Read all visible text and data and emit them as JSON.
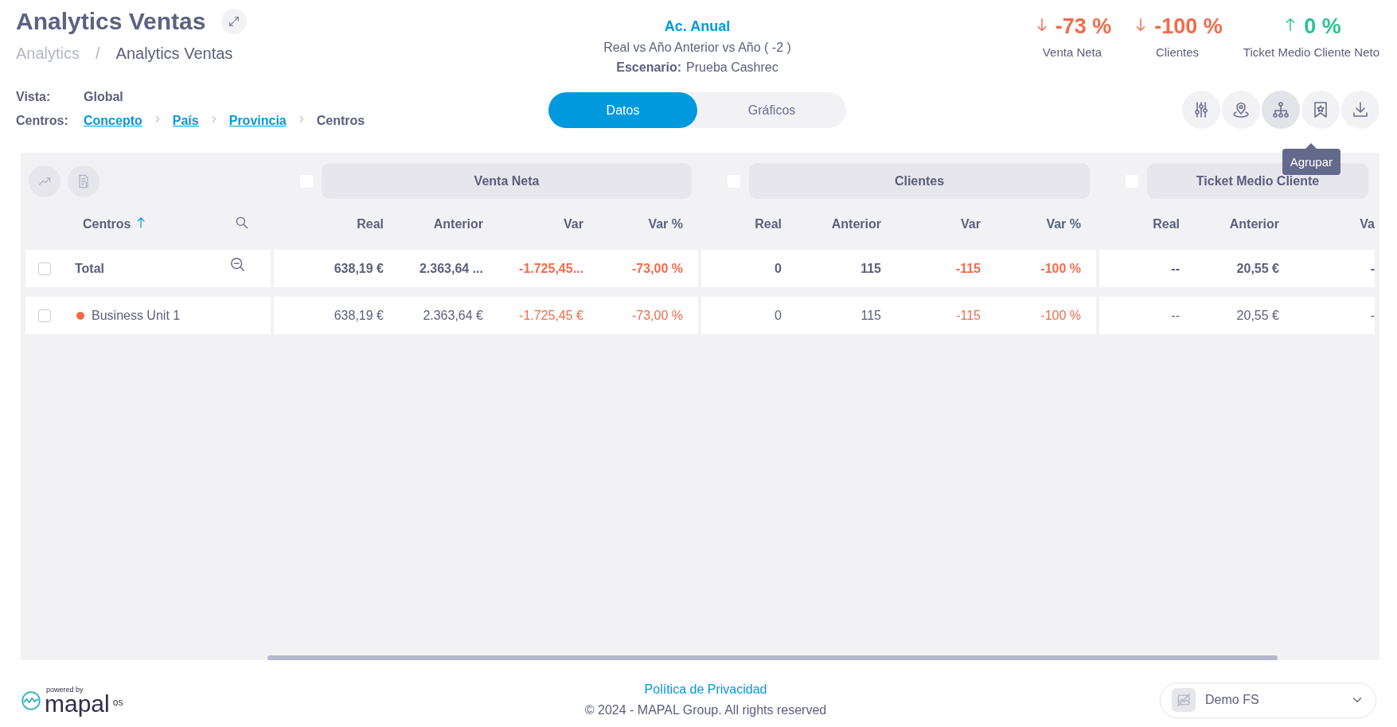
{
  "header": {
    "title": "Analytics Ventas",
    "breadcrumb_separator": "/",
    "breadcrumb": [
      {
        "label": "Analytics",
        "current": false
      },
      {
        "label": "Analytics Ventas",
        "current": true
      }
    ]
  },
  "filters": {
    "vista_label": "Vista:",
    "vista": "Global",
    "centros_label": "Centros:",
    "path": [
      {
        "label": "Concepto",
        "link": true
      },
      {
        "label": "País",
        "link": true
      },
      {
        "label": "Provincia",
        "link": true
      },
      {
        "label": "Centros",
        "link": false
      }
    ]
  },
  "period": {
    "title": "Ac. Anual",
    "comparison": "Real vs Año Anterior vs Año ( -2 )",
    "scenario_label": "Escenario:",
    "scenario": "Prueba Cashrec"
  },
  "view_tabs": [
    {
      "label": "Datos",
      "selected": true
    },
    {
      "label": "Gráficos",
      "selected": false
    }
  ],
  "kpis": [
    {
      "value": "-73 %",
      "label": "Venta Neta",
      "kind": "down"
    },
    {
      "value": "-100 %",
      "label": "Clientes",
      "kind": "down"
    },
    {
      "value": "0 %",
      "label": "Ticket Medio Cliente Neto",
      "kind": "up"
    }
  ],
  "toolbar": {
    "buttons": [
      {
        "kind": "settings",
        "hovered": false
      },
      {
        "kind": "location",
        "hovered": false
      },
      {
        "kind": "group",
        "hovered": true
      },
      {
        "kind": "bookmark",
        "hovered": false
      },
      {
        "kind": "download",
        "hovered": false
      }
    ],
    "tooltip": "Agrupar"
  },
  "table": {
    "tools": [
      {
        "kind": "chart",
        "disabled": true
      },
      {
        "kind": "report",
        "disabled": true
      }
    ],
    "name_column": "Centros",
    "groups": [
      {
        "title": "Venta Neta",
        "checked": false,
        "columns": [
          {
            "label": "Real",
            "kind": "amount"
          },
          {
            "label": "Anterior",
            "kind": "amount"
          },
          {
            "label": "Var",
            "kind": "variance"
          },
          {
            "label": "Var %",
            "kind": "variance"
          }
        ]
      },
      {
        "title": "Clientes",
        "checked": false,
        "columns": [
          {
            "label": "Real",
            "kind": "amount"
          },
          {
            "label": "Anterior",
            "kind": "amount"
          },
          {
            "label": "Var",
            "kind": "variance"
          },
          {
            "label": "Var %",
            "kind": "variance"
          }
        ]
      },
      {
        "title": "Ticket Medio Cliente",
        "checked": false,
        "columns": [
          {
            "label": "Real",
            "kind": "amount"
          },
          {
            "label": "Anterior",
            "kind": "amount"
          },
          {
            "label": "Va",
            "kind": "amount"
          }
        ]
      }
    ],
    "rows": [
      {
        "kind": "total",
        "name": "Total",
        "checked": false,
        "cells": [
          [
            "638,19 €",
            "2.363,64 ...",
            "-1.725,45...",
            "-73,00 %"
          ],
          [
            "0",
            "115",
            "-115",
            "-100 %"
          ],
          [
            "--",
            "20,55 €",
            "-"
          ]
        ]
      },
      {
        "kind": "item",
        "name": "Business Unit 1",
        "checked": false,
        "color": "#f26b4a",
        "cells": [
          [
            "638,19 €",
            "2.363,64 €",
            "-1.725,45 €",
            "-73,00 %"
          ],
          [
            "0",
            "115",
            "-115",
            "-100 %"
          ],
          [
            "--",
            "20,55 €",
            "-"
          ]
        ]
      }
    ]
  },
  "footer": {
    "powered_by": "powered by",
    "brand": "mapal",
    "brand_suffix": "os",
    "privacy_link": "Política de Privacidad",
    "copyright": "© 2024 - MAPAL Group. All rights reserved",
    "account": "Demo FS"
  }
}
